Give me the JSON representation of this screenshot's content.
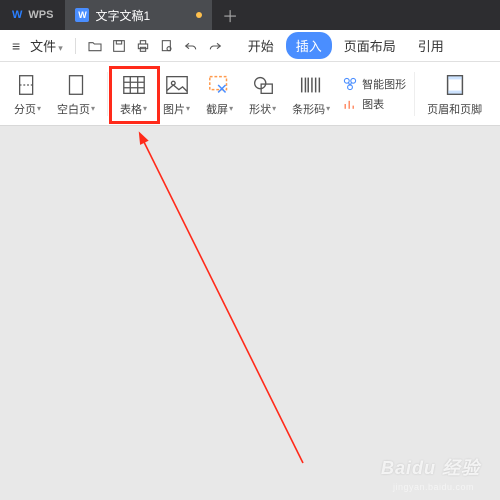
{
  "app": {
    "brand": "WPS"
  },
  "tabs": {
    "doc_icon_letter": "W",
    "doc_title": "文字文稿1",
    "newtab": "＋"
  },
  "menubar": {
    "file": "文件",
    "tabs": {
      "start": "开始",
      "insert": "插入",
      "layout": "页面布局",
      "reference": "引用"
    }
  },
  "ribbon": {
    "paging": "分页",
    "blank": "空白页",
    "table": "表格",
    "image": "图片",
    "screenshot": "截屏",
    "shape": "形状",
    "barcode": "条形码",
    "smartart": "智能图形",
    "chart": "图表",
    "headerfooter": "页眉和页脚"
  },
  "watermark": {
    "main": "Baidu 经验",
    "sub": "jingyan.baidu.com"
  },
  "annotation": {
    "target": "table-button"
  }
}
